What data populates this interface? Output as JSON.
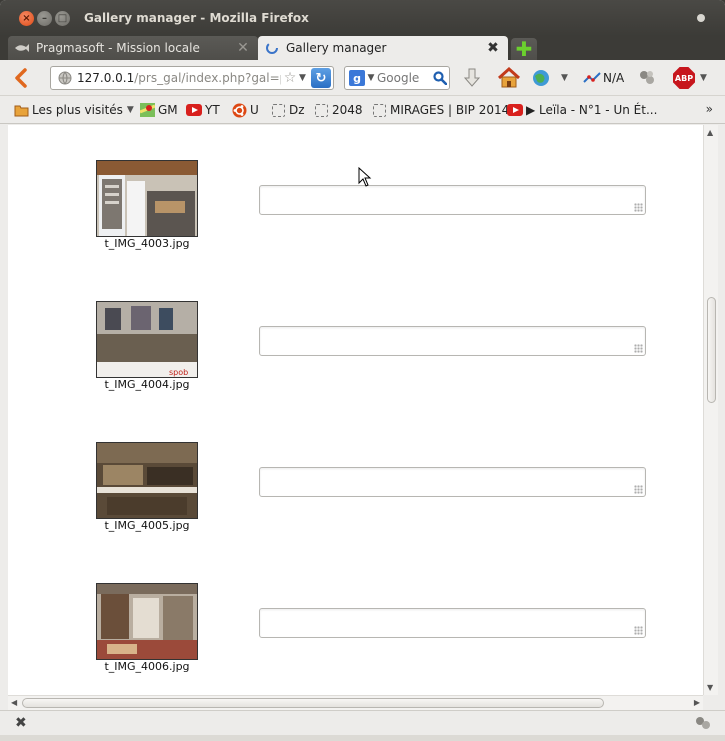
{
  "window": {
    "title": "Gallery manager - Mozilla Firefox"
  },
  "tabs": [
    {
      "label": "Pragmasoft - Mission locale",
      "active": false
    },
    {
      "label": "Gallery manager",
      "active": true
    }
  ],
  "navbar": {
    "url_host": "127.0.0.1",
    "url_path": "/prs_gal/index.php?gal=pr",
    "search_placeholder": "Google",
    "na_label": "N/A",
    "abp_label": "ABP"
  },
  "bookmarks": [
    {
      "label": "Les plus visités",
      "icon": "folder-icon",
      "dropdown": true
    },
    {
      "label": "GM",
      "icon": "maps-icon"
    },
    {
      "label": "YT",
      "icon": "youtube-icon"
    },
    {
      "label": "U",
      "icon": "ubuntu-icon"
    },
    {
      "label": "Dz",
      "icon": "blank-page-icon"
    },
    {
      "label": "2048",
      "icon": "blank-page-icon"
    },
    {
      "label": "MIRAGES | BIP 2014",
      "icon": "blank-page-icon"
    },
    {
      "label": "▶ Leïla - N°1 - Un Ét...",
      "icon": "youtube-icon"
    }
  ],
  "gallery": {
    "items": [
      {
        "filename": "t_IMG_4003.jpg",
        "description": ""
      },
      {
        "filename": "t_IMG_4004.jpg",
        "description": ""
      },
      {
        "filename": "t_IMG_4005.jpg",
        "description": ""
      },
      {
        "filename": "t_IMG_4006.jpg",
        "description": ""
      }
    ]
  },
  "colors": {
    "titlebar": "#3c3b37",
    "back_arrow": "#e0681f",
    "youtube_red": "#d8201d",
    "abp_red": "#c7161d",
    "newtab_green": "#6bd02e"
  }
}
